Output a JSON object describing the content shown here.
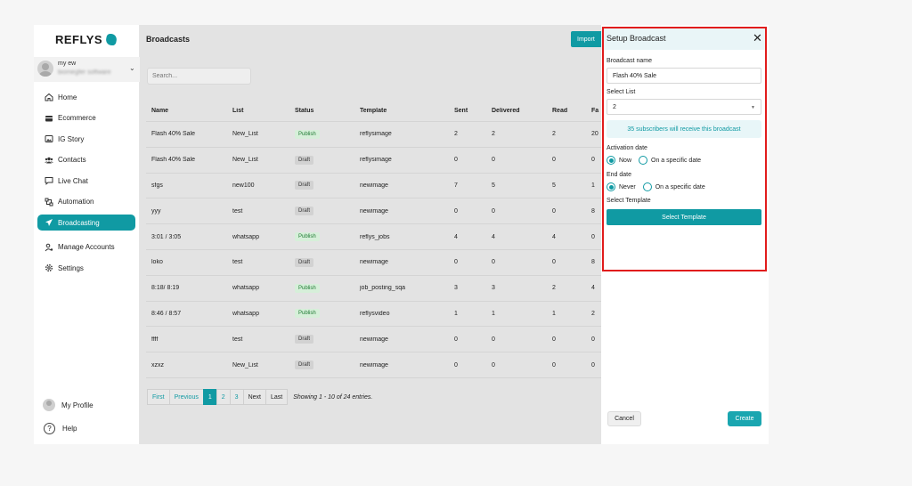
{
  "brand": {
    "name": "REFLYS",
    "accent": "#109aa3"
  },
  "account": {
    "name": "my ew",
    "subtitle": "biomegfer software"
  },
  "nav": {
    "items": [
      {
        "label": "Home",
        "icon": "home-icon"
      },
      {
        "label": "Ecommerce",
        "icon": "store-icon"
      },
      {
        "label": "IG Story",
        "icon": "image-icon"
      },
      {
        "label": "Contacts",
        "icon": "users-icon"
      },
      {
        "label": "Live Chat",
        "icon": "chat-icon"
      },
      {
        "label": "Automation",
        "icon": "automation-icon"
      },
      {
        "label": "Broadcasting",
        "icon": "send-icon",
        "active": true
      },
      {
        "label": "Manage Accounts",
        "icon": "user-gear-icon"
      },
      {
        "label": "Settings",
        "icon": "gear-icon"
      }
    ],
    "bottom": {
      "profile": "My Profile",
      "help": "Help"
    }
  },
  "main": {
    "title": "Broadcasts",
    "import_label": "Import",
    "search_placeholder": "Search..."
  },
  "table": {
    "headers": [
      "Name",
      "List",
      "Status",
      "Template",
      "Sent",
      "Delivered",
      "Read",
      "Fa"
    ],
    "rows": [
      {
        "name": "Flash 40% Sale",
        "list": "New_List",
        "status": "Publish",
        "template": "reflysimage",
        "sent": "2",
        "delivered": "2",
        "read": "2",
        "fa": "20"
      },
      {
        "name": "Flash 40% Sale",
        "list": "New_List",
        "status": "Draft",
        "template": "reflysimage",
        "sent": "0",
        "delivered": "0",
        "read": "0",
        "fa": "0"
      },
      {
        "name": "sfgs",
        "list": "new100",
        "status": "Draft",
        "template": "newimage",
        "sent": "7",
        "delivered": "5",
        "read": "5",
        "fa": "1"
      },
      {
        "name": "yyy",
        "list": "test",
        "status": "Draft",
        "template": "newimage",
        "sent": "0",
        "delivered": "0",
        "read": "0",
        "fa": "8"
      },
      {
        "name": "3:01 / 3:05",
        "list": "whatsapp",
        "status": "Publish",
        "template": "reflys_jobs",
        "sent": "4",
        "delivered": "4",
        "read": "4",
        "fa": "0"
      },
      {
        "name": "loko",
        "list": "test",
        "status": "Draft",
        "template": "newimage",
        "sent": "0",
        "delivered": "0",
        "read": "0",
        "fa": "8"
      },
      {
        "name": "8:18/ 8:19",
        "list": "whatsapp",
        "status": "Publish",
        "template": "job_posting_sqa",
        "sent": "3",
        "delivered": "3",
        "read": "2",
        "fa": "4"
      },
      {
        "name": "8:46 / 8:57",
        "list": "whatsapp",
        "status": "Publish",
        "template": "reflysvideo",
        "sent": "1",
        "delivered": "1",
        "read": "1",
        "fa": "2"
      },
      {
        "name": "ffff",
        "list": "test",
        "status": "Draft",
        "template": "newimage",
        "sent": "0",
        "delivered": "0",
        "read": "0",
        "fa": "0"
      },
      {
        "name": "xzxz",
        "list": "New_List",
        "status": "Draft",
        "template": "newimage",
        "sent": "0",
        "delivered": "0",
        "read": "0",
        "fa": "0"
      }
    ]
  },
  "pagination": {
    "first": "First",
    "previous": "Previous",
    "pages": [
      "1",
      "2",
      "3"
    ],
    "current": "1",
    "next": "Next",
    "last": "Last",
    "info": "Showing 1 - 10 of 24 entries."
  },
  "modal": {
    "title": "Setup Broadcast",
    "name_label": "Broadcast name",
    "name_value": "Flash 40% Sale",
    "list_label": "Select List",
    "list_value": "2",
    "subscribers_info": "35 subscribers will receive this broadcast",
    "activation_label": "Activation date",
    "activation_now": "Now",
    "activation_specific": "On a specific date",
    "end_label": "End date",
    "end_never": "Never",
    "end_specific": "On a specific date",
    "template_label": "Select Template",
    "template_button": "Select Template",
    "cancel": "Cancel",
    "create": "Create"
  }
}
